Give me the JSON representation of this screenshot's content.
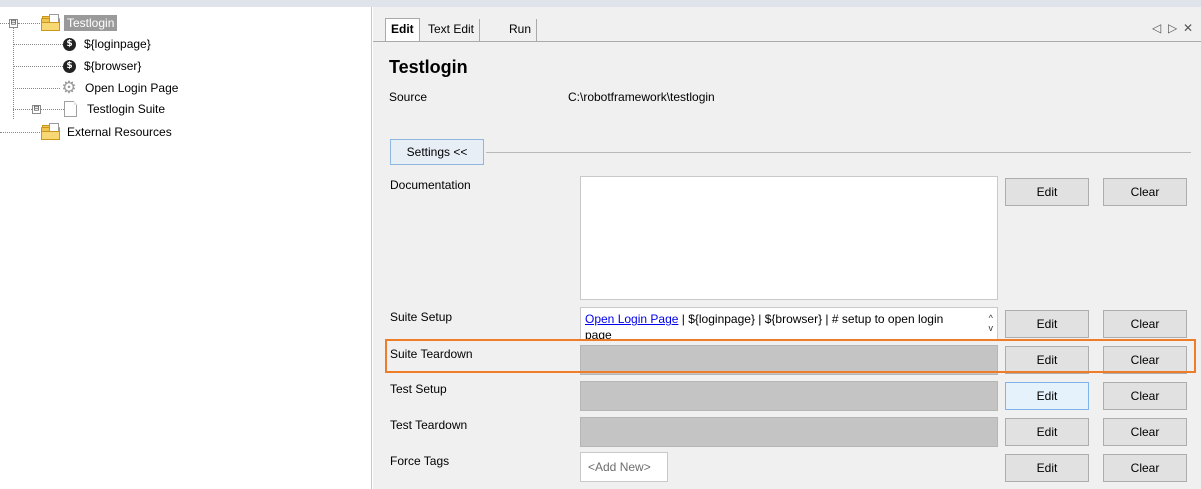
{
  "tree": {
    "root_label": "Testlogin",
    "items": [
      {
        "label": "${loginpage}",
        "icon": "dollar-icon"
      },
      {
        "label": "${browser}",
        "icon": "dollar-icon"
      },
      {
        "label": "Open Login Page",
        "icon": "gear-icon"
      },
      {
        "label": "Testlogin Suite",
        "icon": "page-icon"
      },
      {
        "label": "External Resources",
        "icon": "folder-icon"
      }
    ],
    "expander_symbol": "⊟"
  },
  "tabs": [
    {
      "label": "Edit",
      "active": true
    },
    {
      "label": "Text Edit",
      "active": false
    },
    {
      "label": "Run",
      "active": false
    }
  ],
  "tab_controls": {
    "prev": "◁",
    "next": "▷",
    "close": "✕"
  },
  "editor": {
    "title": "Testlogin",
    "source_label": "Source",
    "source_value": "C:\\robotframework\\testlogin",
    "settings_button": "Settings <<",
    "rows": [
      {
        "label": "Documentation",
        "value": "",
        "edit": "Edit",
        "clear": "Clear"
      },
      {
        "label": "Suite Setup",
        "keyword": "Open Login Page",
        "value_rest": " | ${loginpage} | ${browser} | # setup to open login page",
        "edit": "Edit",
        "clear": "Clear"
      },
      {
        "label": "Suite Teardown",
        "value": "",
        "edit": "Edit",
        "clear": "Clear"
      },
      {
        "label": "Test Setup",
        "value": "",
        "edit": "Edit",
        "clear": "Clear"
      },
      {
        "label": "Test Teardown",
        "value": "",
        "edit": "Edit",
        "clear": "Clear"
      },
      {
        "label": "Force Tags",
        "placeholder": "<Add New>",
        "edit": "Edit",
        "clear": "Clear"
      }
    ],
    "scroll_up": "^",
    "scroll_down": "v"
  },
  "colors": {
    "highlight": "#ee7d2a",
    "link": "#0000ee",
    "selected_node": "#9a9a9a"
  }
}
